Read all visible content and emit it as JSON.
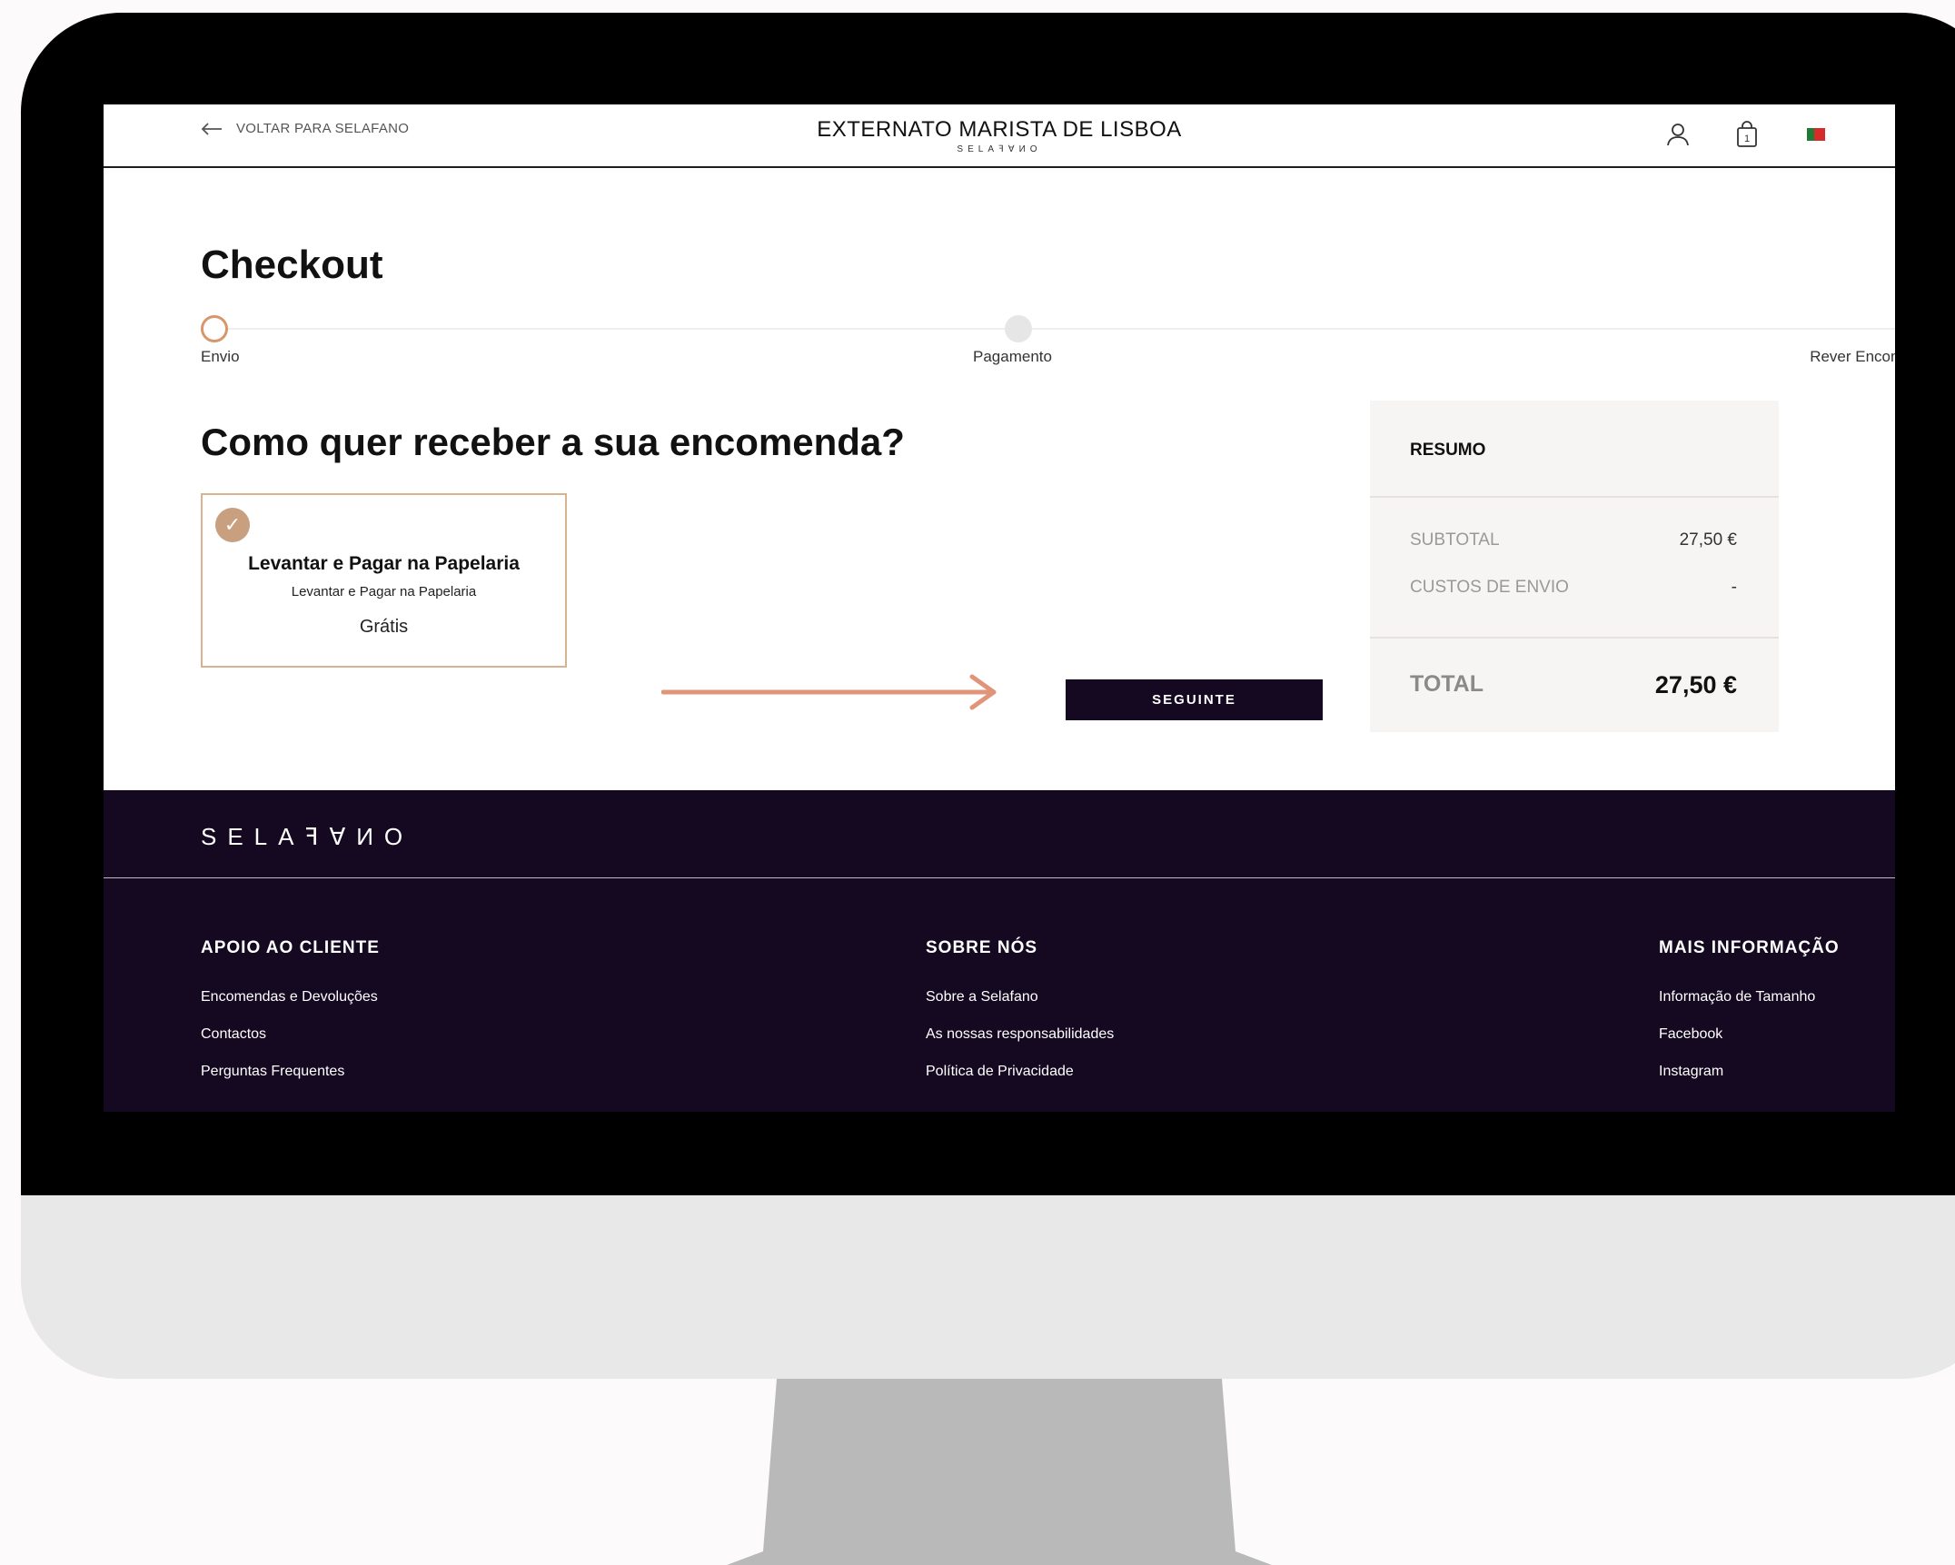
{
  "header": {
    "back_label": "VOLTAR PARA SELAFANO",
    "store_title": "EXTERNATO MARISTA DE LISBOA",
    "brand_sub": "SELAꟻⱯИO",
    "icons": [
      "user-icon",
      "shopping-bag-icon",
      "portugal-flag-icon"
    ],
    "cart_count": "1"
  },
  "page": {
    "title": "Checkout",
    "question": "Como quer receber a sua encomenda?"
  },
  "steps": [
    {
      "label": "Envio",
      "active": true
    },
    {
      "label": "Pagamento",
      "active": false
    },
    {
      "label": "Rever Encomenda",
      "active": false
    }
  ],
  "shipping_option": {
    "title": "Levantar e Pagar na Papelaria",
    "subtitle": "Levantar e Pagar na Papelaria",
    "price": "Grátis",
    "selected": true,
    "check_glyph": "✓"
  },
  "next_button": "SEGUINTE",
  "summary": {
    "title": "RESUMO",
    "subtotal_label": "SUBTOTAL",
    "subtotal_value": "27,50 €",
    "shipping_label": "CUSTOS DE ENVIO",
    "shipping_value": "-",
    "total_label": "TOTAL",
    "total_value": "27,50 €"
  },
  "footer": {
    "logo": "SELAꟻⱯИO",
    "columns": [
      {
        "title": "APOIO AO CLIENTE",
        "links": [
          "Encomendas e Devoluções",
          "Contactos",
          "Perguntas Frequentes"
        ]
      },
      {
        "title": "SOBRE NÓS",
        "links": [
          "Sobre a Selafano",
          "As nossas responsabilidades",
          "Política de Privacidade"
        ]
      },
      {
        "title": "MAIS INFORMAÇÃO",
        "links": [
          "Informação de Tamanho",
          "Facebook",
          "Instagram"
        ]
      }
    ]
  },
  "colors": {
    "accent": "#d8966b",
    "dark": "#150821",
    "check": "#c8a07f",
    "arrow": "#e0957a"
  }
}
